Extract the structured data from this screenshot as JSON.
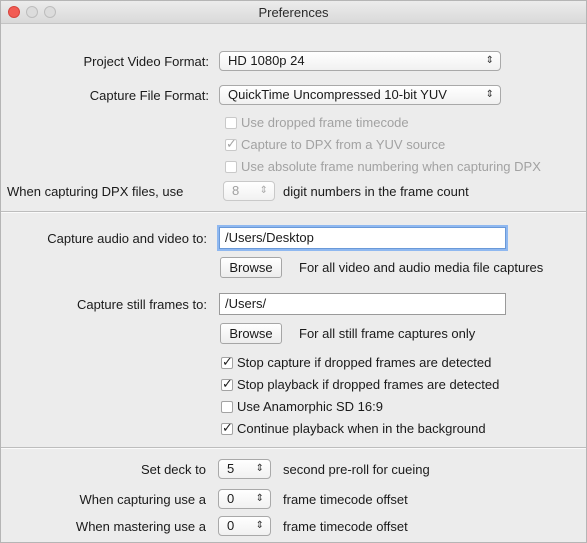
{
  "window": {
    "title": "Preferences"
  },
  "format": {
    "project_video_label": "Project Video Format:",
    "project_video_value": "HD 1080p 24",
    "capture_file_label": "Capture File Format:",
    "capture_file_value": "QuickTime Uncompressed 10-bit YUV",
    "options": [
      {
        "label": "Use dropped frame timecode",
        "checked": false,
        "enabled": false
      },
      {
        "label": "Capture to DPX from a YUV source",
        "checked": true,
        "enabled": false
      },
      {
        "label": "Use absolute frame numbering when capturing DPX",
        "checked": false,
        "enabled": false
      }
    ],
    "dpx_prefix": "When capturing DPX files, use",
    "dpx_digits": "8",
    "dpx_suffix": "digit numbers in the frame count"
  },
  "capture": {
    "av_label": "Capture audio and video to:",
    "av_path": "/Users/Desktop",
    "browse_label": "Browse",
    "av_hint": "For all video and audio media file captures",
    "still_label": "Capture still frames to:",
    "still_path": "/Users/",
    "still_hint": "For all still frame captures only",
    "options": [
      {
        "label": "Stop capture if dropped frames are detected",
        "checked": true
      },
      {
        "label": "Stop playback if dropped frames are detected",
        "checked": true
      },
      {
        "label": "Use Anamorphic SD 16:9",
        "checked": false
      },
      {
        "label": "Continue playback when in the background",
        "checked": true
      }
    ]
  },
  "deck": {
    "preroll_label": "Set deck to",
    "preroll_value": "5",
    "preroll_suffix": "second pre-roll for cueing",
    "capture_offset_label": "When capturing use a",
    "capture_offset_value": "0",
    "capture_offset_suffix": "frame timecode offset",
    "master_offset_label": "When mastering use a",
    "master_offset_value": "0",
    "master_offset_suffix": "frame timecode offset"
  }
}
